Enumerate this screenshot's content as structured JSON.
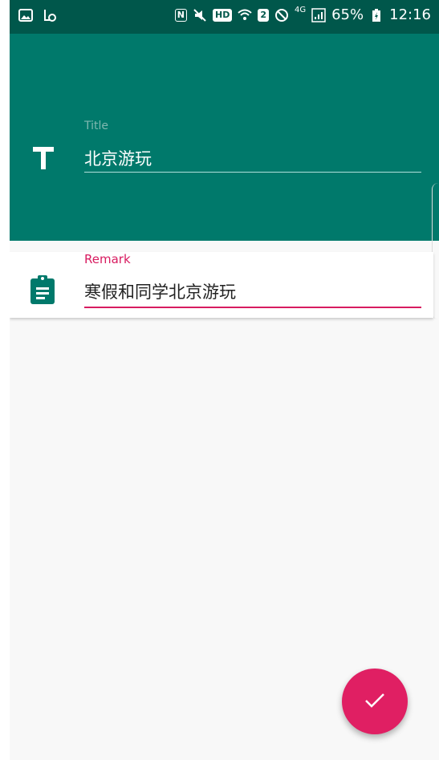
{
  "status_bar": {
    "nfc_label": "N",
    "hd_label": "HD",
    "sim_label": "2",
    "network_label": "4G",
    "battery_percent": "65%",
    "time": "12:16"
  },
  "form": {
    "title": {
      "label": "Title",
      "value": "北京游玩"
    },
    "remark": {
      "label": "Remark",
      "value": "寒假和同学北京游玩"
    }
  },
  "colors": {
    "primary": "#00796b",
    "primary_dark": "#00574b",
    "accent": "#e01f63"
  },
  "icons": {
    "title": "title-text-icon",
    "remark": "clipboard-icon",
    "fab": "check-icon"
  }
}
